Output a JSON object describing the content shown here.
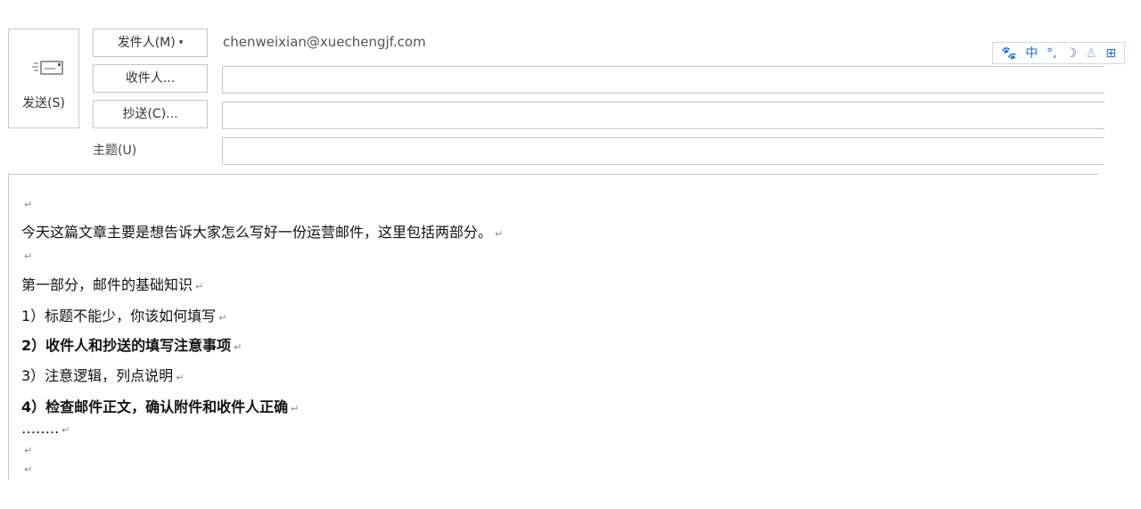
{
  "header": {
    "send_label": "发送(S)",
    "from_button_label": "发件人(M)",
    "from_caret": "▾",
    "from_value": "chenweixian@xuechengjf.com",
    "to_button_label": "收件人...",
    "cc_button_label": "抄送(C)...",
    "subject_label": "主题(U)",
    "to_value": "",
    "cc_value": "",
    "subject_value": ""
  },
  "ime": {
    "items": [
      "🐾",
      "中",
      "°,",
      "☽",
      "♙",
      "⊞"
    ]
  },
  "body": {
    "return_mark": "↵",
    "lines": [
      "",
      "今天这篇文章主要是想告诉大家怎么写好一份运营邮件，这里包括两部分。",
      "",
      "第一部分，邮件的基础知识",
      "1）标题不能少，你该如何填写",
      "2）收件人和抄送的填写注意事项",
      "3）注意逻辑，列点说明",
      "4）检查邮件正文，确认附件和收件人正确",
      "……..",
      "",
      ""
    ]
  },
  "colors": {
    "border": "#c6c6c6",
    "ime_accent": "#2a6bd0"
  }
}
